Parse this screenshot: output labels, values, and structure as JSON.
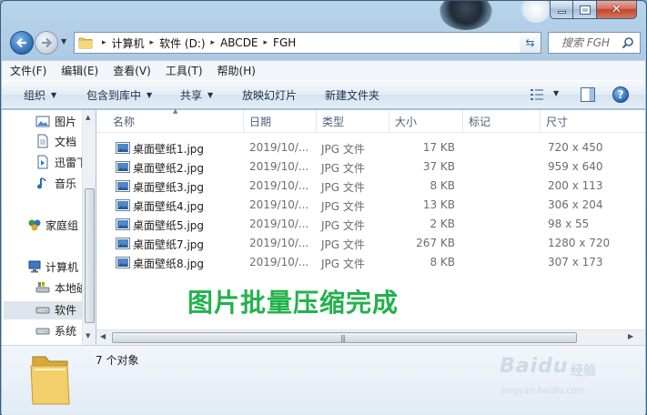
{
  "window": {
    "caption": {
      "minimize": "",
      "maximize": "",
      "close": "✕"
    }
  },
  "address": {
    "crumbs": [
      "计算机",
      "软件 (D:)",
      "ABCDE",
      "FGH"
    ],
    "separator": "▸",
    "search_placeholder": "搜索 FGH"
  },
  "menubar": {
    "items": [
      "文件(F)",
      "编辑(E)",
      "查看(V)",
      "工具(T)",
      "帮助(H)"
    ]
  },
  "toolbar": {
    "organize": "组织",
    "include_in_library": "包含到库中",
    "share": "共享",
    "slideshow": "放映幻灯片",
    "new_folder": "新建文件夹",
    "help": "?"
  },
  "nav": {
    "items": [
      "图片",
      "文档",
      "迅雷下载",
      "音乐",
      "家庭组",
      "计算机",
      "本地磁盘",
      "软件",
      "系统"
    ],
    "icons": [
      "picture-icon",
      "document-icon",
      "xunlei-icon",
      "music-icon",
      "homegroup-icon",
      "computer-icon",
      "local-disk-icon",
      "drive-icon",
      "drive-icon"
    ]
  },
  "columns": [
    "名称",
    "日期",
    "类型",
    "大小",
    "标记",
    "尺寸"
  ],
  "files": [
    {
      "name": "桌面壁纸1.jpg",
      "date": "2019/10/...",
      "type": "JPG 文件",
      "size": "17 KB",
      "dims": "720 x 450"
    },
    {
      "name": "桌面壁纸2.jpg",
      "date": "2019/10/...",
      "type": "JPG 文件",
      "size": "37 KB",
      "dims": "959 x 640"
    },
    {
      "name": "桌面壁纸3.jpg",
      "date": "2019/10/...",
      "type": "JPG 文件",
      "size": "8 KB",
      "dims": "200 x 113"
    },
    {
      "name": "桌面壁纸4.jpg",
      "date": "2019/10/...",
      "type": "JPG 文件",
      "size": "13 KB",
      "dims": "306 x 204"
    },
    {
      "name": "桌面壁纸5.jpg",
      "date": "2019/10/...",
      "type": "JPG 文件",
      "size": "2 KB",
      "dims": "98 x 55"
    },
    {
      "name": "桌面壁纸7.jpg",
      "date": "2019/10/...",
      "type": "JPG 文件",
      "size": "267 KB",
      "dims": "1280 x 720"
    },
    {
      "name": "桌面壁纸8.jpg",
      "date": "2019/10/...",
      "type": "JPG 文件",
      "size": "8 KB",
      "dims": "307 x 173"
    }
  ],
  "overlay": "图片批量压缩完成",
  "status": {
    "count": "7 个对象"
  },
  "watermark": {
    "brand": "Baidu",
    "jingyan": "经验",
    "url": "jingyan.baidu.com"
  },
  "colors": {
    "overlay_text": "#22b24c",
    "accent": "#2b6cb0"
  }
}
